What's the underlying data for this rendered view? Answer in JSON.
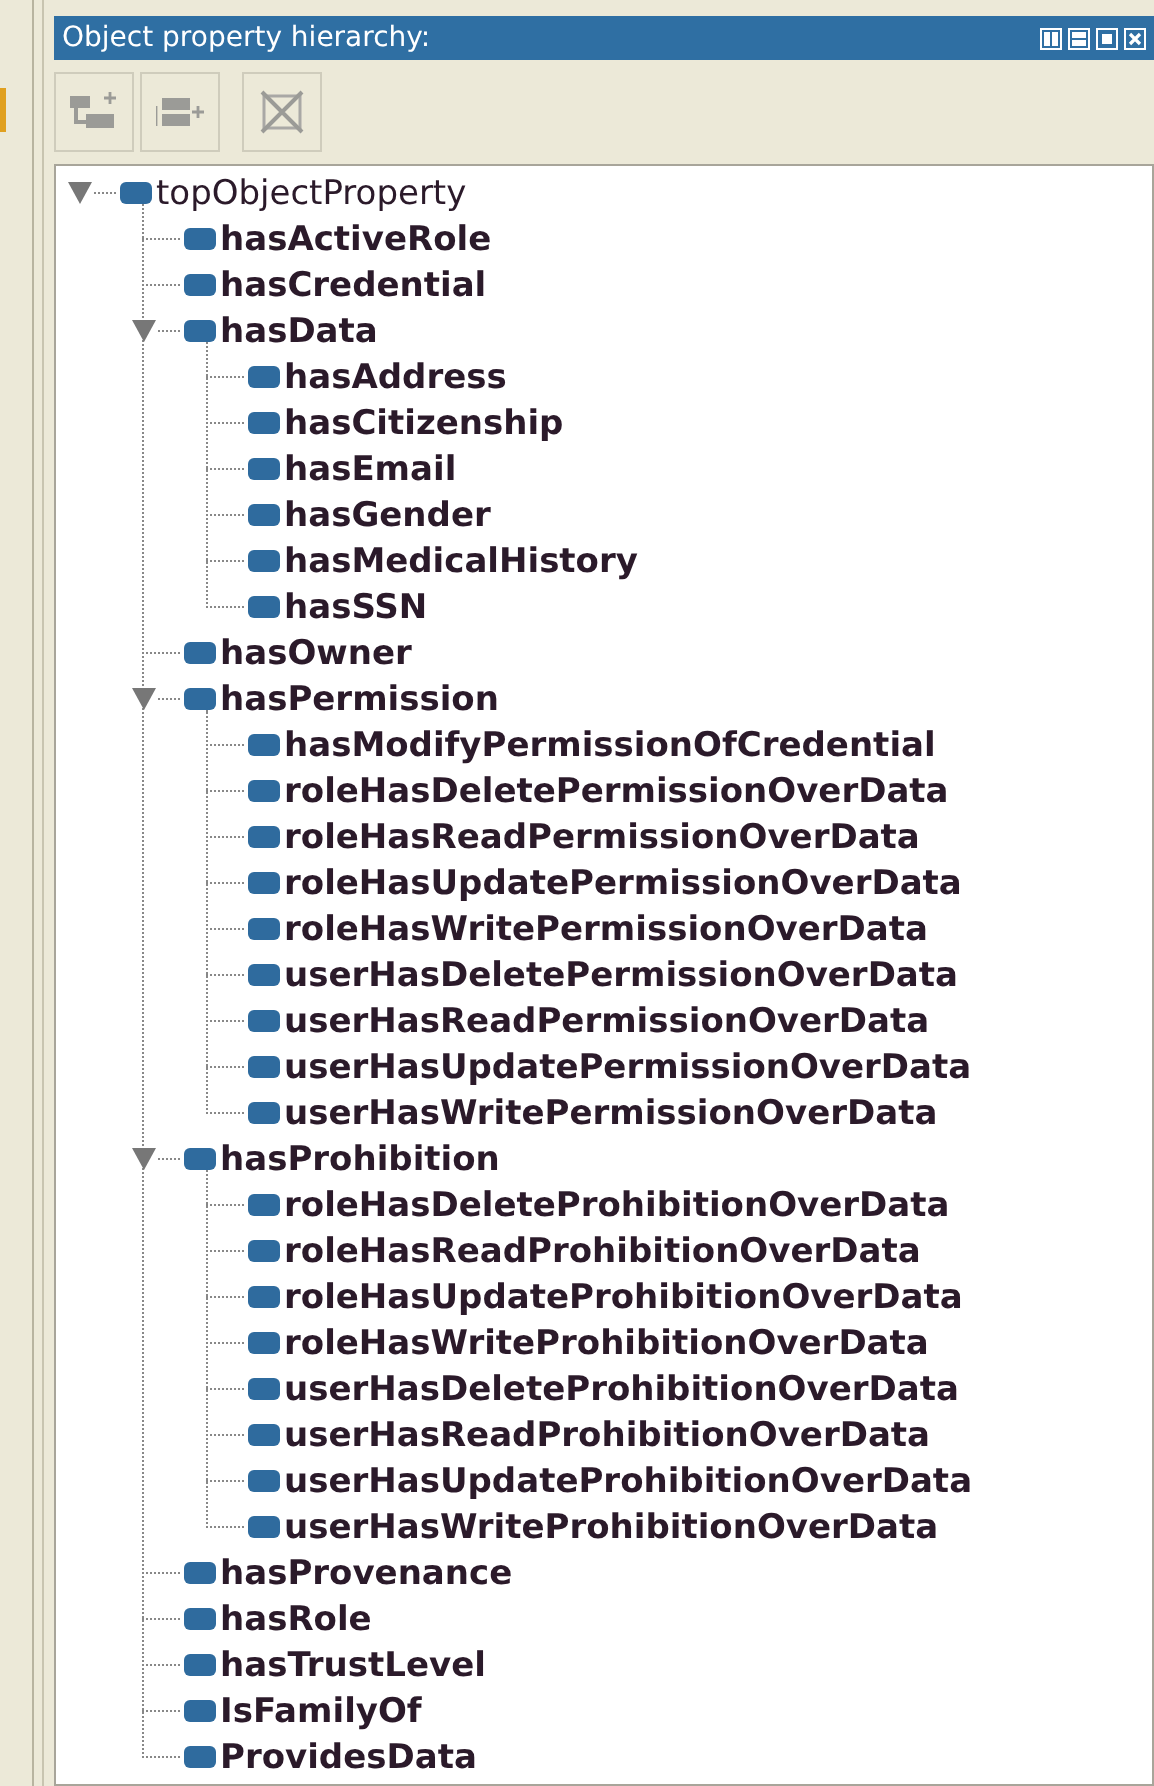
{
  "panel": {
    "title": "Object property hierarchy:"
  },
  "toolbar": [
    {
      "kind": "add-sub",
      "disabled": true
    },
    {
      "kind": "add-sibling",
      "disabled": true
    },
    {
      "kind": "delete",
      "disabled": true
    }
  ],
  "tree": [
    {
      "label": "topObjectProperty",
      "expanded": true,
      "children": [
        {
          "label": "hasActiveRole"
        },
        {
          "label": "hasCredential"
        },
        {
          "label": "hasData",
          "expanded": true,
          "children": [
            {
              "label": "hasAddress"
            },
            {
              "label": "hasCitizenship"
            },
            {
              "label": "hasEmail"
            },
            {
              "label": "hasGender"
            },
            {
              "label": "hasMedicalHistory"
            },
            {
              "label": "hasSSN"
            }
          ]
        },
        {
          "label": "hasOwner"
        },
        {
          "label": "hasPermission",
          "expanded": true,
          "children": [
            {
              "label": "hasModifyPermissionOfCredential"
            },
            {
              "label": "roleHasDeletePermissionOverData"
            },
            {
              "label": "roleHasReadPermissionOverData"
            },
            {
              "label": "roleHasUpdatePermissionOverData"
            },
            {
              "label": "roleHasWritePermissionOverData"
            },
            {
              "label": "userHasDeletePermissionOverData"
            },
            {
              "label": "userHasReadPermissionOverData"
            },
            {
              "label": "userHasUpdatePermissionOverData"
            },
            {
              "label": "userHasWritePermissionOverData"
            }
          ]
        },
        {
          "label": "hasProhibition",
          "expanded": true,
          "children": [
            {
              "label": "roleHasDeleteProhibitionOverData"
            },
            {
              "label": "roleHasReadProhibitionOverData"
            },
            {
              "label": "roleHasUpdateProhibitionOverData"
            },
            {
              "label": "roleHasWriteProhibitionOverData"
            },
            {
              "label": "userHasDeleteProhibitionOverData"
            },
            {
              "label": "userHasReadProhibitionOverData"
            },
            {
              "label": "userHasUpdateProhibitionOverData"
            },
            {
              "label": "userHasWriteProhibitionOverData"
            }
          ]
        },
        {
          "label": "hasProvenance"
        },
        {
          "label": "hasRole"
        },
        {
          "label": "hasTrustLevel"
        },
        {
          "label": "IsFamilyOf"
        },
        {
          "label": "ProvidesData"
        }
      ]
    }
  ]
}
